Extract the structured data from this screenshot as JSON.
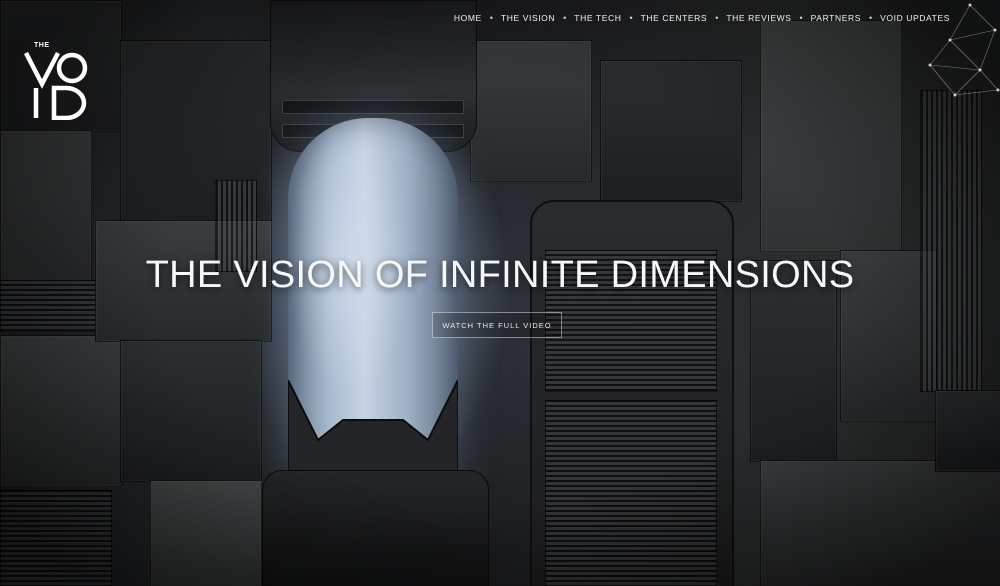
{
  "brand": {
    "logo_small_text": "THE",
    "logo_name": "VOID"
  },
  "nav": {
    "items": [
      {
        "label": "HOME"
      },
      {
        "label": "THE VISION"
      },
      {
        "label": "THE TECH"
      },
      {
        "label": "THE CENTERS"
      },
      {
        "label": "THE REVIEWS"
      },
      {
        "label": "PARTNERS"
      },
      {
        "label": "VOID UPDATES"
      }
    ],
    "separator": "•"
  },
  "hero": {
    "title": "THE VISION OF INFINITE DIMENSIONS",
    "cta_label": "WATCH THE FULL VIDEO"
  },
  "decor": {
    "network_icon": "network-graph-icon",
    "background": "sci-fi-corridor-photo"
  },
  "colors": {
    "text": "#f5f7fa",
    "tube_glow": "#a9bbd0",
    "background": "#1f2124"
  }
}
